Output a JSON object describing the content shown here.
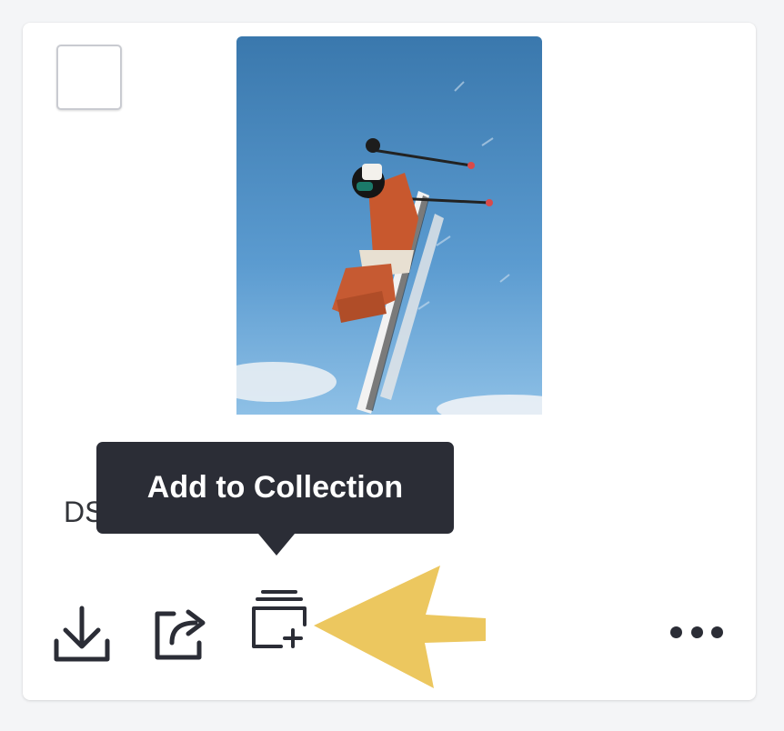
{
  "card": {
    "filename_visible": "DS",
    "tooltip": "Add to Collection"
  },
  "actions": [
    {
      "name": "download",
      "icon": "download-icon"
    },
    {
      "name": "share",
      "icon": "share-icon"
    },
    {
      "name": "add-to-collection",
      "icon": "add-to-collection-icon"
    },
    {
      "name": "more",
      "icon": "more-icon"
    }
  ],
  "colors": {
    "tooltip_bg": "#2b2d36",
    "icon": "#2b2d36",
    "annotation_arrow": "#ecc75f",
    "sky": "#4a8cc4"
  }
}
